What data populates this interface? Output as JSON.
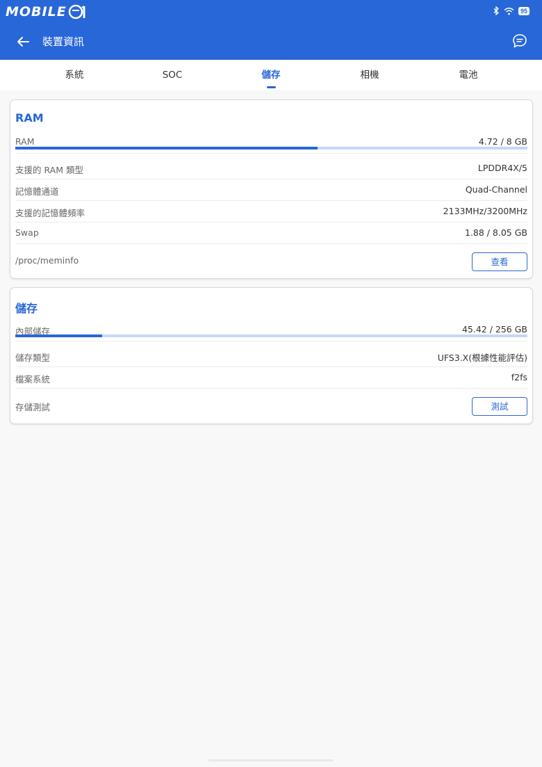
{
  "status_bar": {
    "logo_text": "MOBILE",
    "logo_number": "01",
    "battery": "95"
  },
  "app_bar": {
    "title": "裝置資訊"
  },
  "tabs": [
    {
      "label": "系統"
    },
    {
      "label": "SOC"
    },
    {
      "label": "儲存"
    },
    {
      "label": "相機"
    },
    {
      "label": "電池"
    }
  ],
  "active_tab": "儲存",
  "ram_card": {
    "title": "RAM",
    "usage": {
      "label": "RAM",
      "value": "4.72 / 8 GB",
      "fraction": 0.59
    },
    "rows": [
      {
        "label": "支援的 RAM 類型",
        "value": "LPDDR4X/5"
      },
      {
        "label": "記憶體通道",
        "value": "Quad-Channel"
      },
      {
        "label": "支援的記憶體頻率",
        "value": "2133MHz/3200MHz"
      },
      {
        "label": "Swap",
        "value": "1.88 / 8.05 GB"
      }
    ],
    "action": {
      "label": "/proc/meminfo",
      "button": "查看"
    }
  },
  "storage_card": {
    "title": "儲存",
    "usage": {
      "label": "內部儲存",
      "value": "45.42 / 256 GB",
      "fraction": 0.17
    },
    "rows": [
      {
        "label": "儲存類型",
        "value": "UFS3.X(根據性能評估)"
      },
      {
        "label": "檔案系統",
        "value": "f2fs"
      }
    ],
    "action": {
      "label": "存儲測試",
      "button": "測試"
    }
  },
  "colors": {
    "accent": "#2867d7",
    "bar_track": "#c6d7f6",
    "background": "#f8f8f8"
  }
}
